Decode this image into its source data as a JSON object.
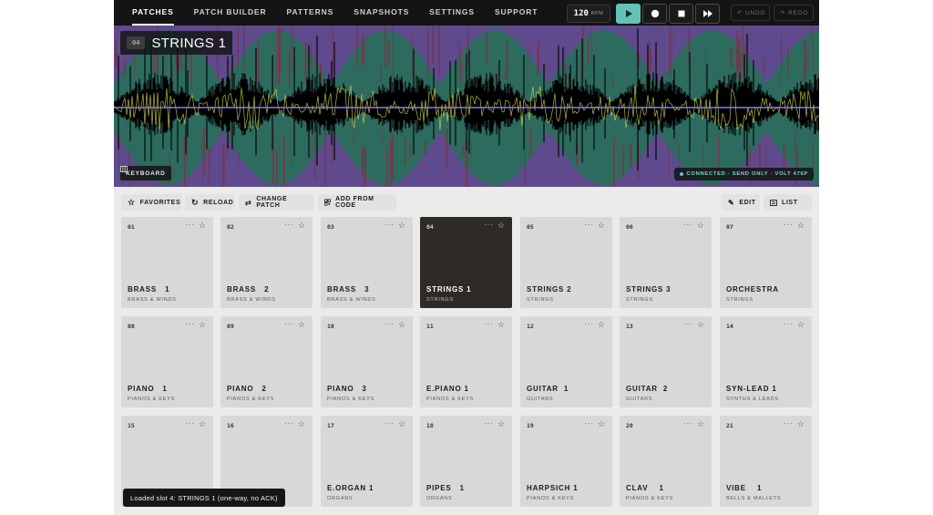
{
  "nav": {
    "items": [
      "PATCHES",
      "PATCH BUILDER",
      "PATTERNS",
      "SNAPSHOTS",
      "SETTINGS",
      "SUPPORT"
    ],
    "active_index": 0
  },
  "transport": {
    "bpm_value": "120",
    "bpm_unit": "BPM",
    "play_icon": "play-icon",
    "record_icon": "record-icon",
    "stop_icon": "stop-icon",
    "fast_forward_icon": "fast-forward-icon",
    "undo_label": "UNDO",
    "redo_label": "REDO",
    "accent_color": "#62c2b8"
  },
  "waveform": {
    "patch_number": "04",
    "patch_name": "STRINGS 1",
    "keyboard_label": "KEYBOARD",
    "status_text": "CONNECTED · SEND ONLY · VOLT 476P",
    "colors": {
      "purple": "#5e4a8c",
      "teal": "#2d6b5e",
      "maroon": "#7a3148",
      "signal": "#000000",
      "yellow": "#c9cc4a",
      "line": "#8a7cf0"
    }
  },
  "toolbar": {
    "favorites": "FAVORITES",
    "reload": "RELOAD",
    "change_patch": "CHANGE PATCH",
    "add_from_code": "ADD FROM CODE",
    "edit": "EDIT",
    "list": "LIST"
  },
  "patches": [
    {
      "num": "01",
      "name": "BRASS   1",
      "category": "BRASS & WINDS"
    },
    {
      "num": "02",
      "name": "BRASS   2",
      "category": "BRASS & WINDS"
    },
    {
      "num": "03",
      "name": "BRASS   3",
      "category": "BRASS & WINDS"
    },
    {
      "num": "04",
      "name": "STRINGS 1",
      "category": "STRINGS",
      "active": true
    },
    {
      "num": "05",
      "name": "STRINGS 2",
      "category": "STRINGS"
    },
    {
      "num": "06",
      "name": "STRINGS 3",
      "category": "STRINGS"
    },
    {
      "num": "07",
      "name": "ORCHESTRA",
      "category": "STRINGS"
    },
    {
      "num": "08",
      "name": "PIANO   1",
      "category": "PIANOS & KEYS"
    },
    {
      "num": "09",
      "name": "PIANO   2",
      "category": "PIANOS & KEYS"
    },
    {
      "num": "10",
      "name": "PIANO   3",
      "category": "PIANOS & KEYS"
    },
    {
      "num": "11",
      "name": "E.PIANO 1",
      "category": "PIANOS & KEYS"
    },
    {
      "num": "12",
      "name": "GUITAR  1",
      "category": "GUITARS"
    },
    {
      "num": "13",
      "name": "GUITAR  2",
      "category": "GUITARS"
    },
    {
      "num": "14",
      "name": "SYN-LEAD 1",
      "category": "SYNTHS & LEADS"
    },
    {
      "num": "15",
      "name": "",
      "category": ""
    },
    {
      "num": "16",
      "name": "",
      "category": ""
    },
    {
      "num": "17",
      "name": "E.ORGAN 1",
      "category": "ORGANS"
    },
    {
      "num": "18",
      "name": "PIPES   1",
      "category": "ORGANS"
    },
    {
      "num": "19",
      "name": "HARPSICH 1",
      "category": "PIANOS & KEYS"
    },
    {
      "num": "20",
      "name": "CLAV    1",
      "category": "PIANOS & KEYS"
    },
    {
      "num": "21",
      "name": "VIBE    1",
      "category": "BELLS & MALLETS"
    }
  ],
  "card_more": "···",
  "card_star": "☆",
  "toast": "Loaded slot 4: STRINGS 1 (one-way, no ACK)"
}
